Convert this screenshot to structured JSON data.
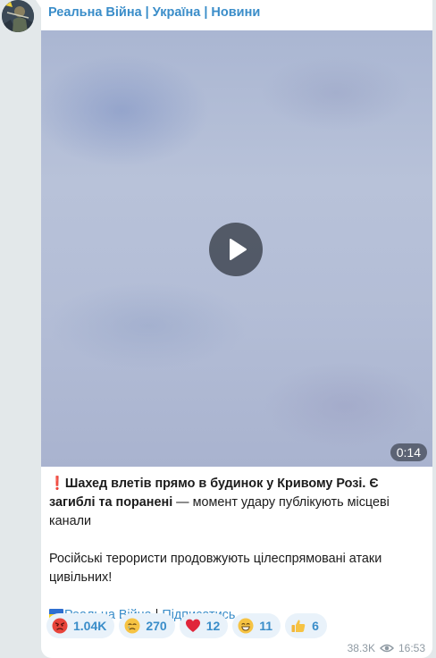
{
  "channel": {
    "name": "Реальна Війна | Україна | Новини"
  },
  "video": {
    "duration": "0:14"
  },
  "post": {
    "alert_icon": "❗",
    "headline": "Шахед влетів прямо в будинок у Кривому Розі. Є загиблі та поранені",
    "headline_tail": " — момент удару публікують місцеві канали",
    "paragraph": "Російські терористи продовжують цілеспрямовані атаки цивільних!",
    "signature_link": "Реальна Війна",
    "signature_sep": " | ",
    "subscribe_link": "Підписатись"
  },
  "reactions": [
    {
      "icon": "angry-face-icon",
      "count": "1.04K"
    },
    {
      "icon": "crying-face-icon",
      "count": "270"
    },
    {
      "icon": "red-heart-icon",
      "count": "12"
    },
    {
      "icon": "grinning-face-icon",
      "count": "11"
    },
    {
      "icon": "thumbs-up-icon",
      "count": "6"
    }
  ],
  "meta": {
    "views": "38.3K",
    "time": "16:53"
  },
  "colors": {
    "accent": "#3a8dc9",
    "background": "#e3e8ea",
    "bubble": "#ffffff",
    "reaction_bg": "#e9f2fa"
  }
}
